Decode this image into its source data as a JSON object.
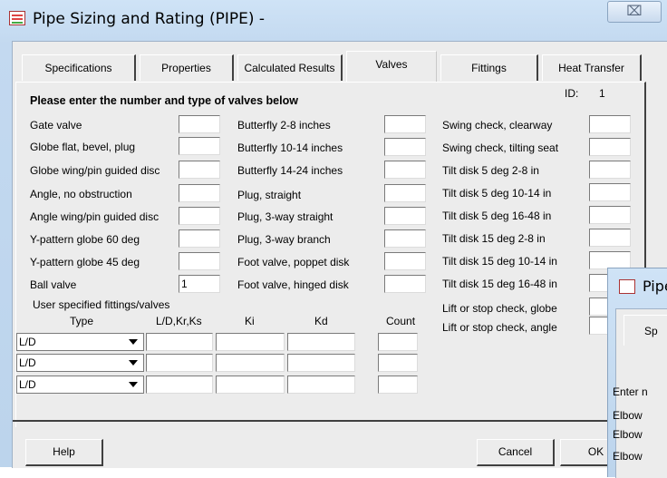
{
  "window": {
    "title": "Pipe Sizing and Rating (PIPE)  -",
    "close_glyph": "⌧"
  },
  "tabs": [
    {
      "label": "Specifications"
    },
    {
      "label": "Properties"
    },
    {
      "label": "Calculated Results"
    },
    {
      "label": "Valves"
    },
    {
      "label": "Fittings"
    },
    {
      "label": "Heat Transfer"
    }
  ],
  "panel": {
    "heading": "Please enter the number and type of valves below",
    "id_label": "ID:",
    "id_value": "1"
  },
  "valves_col1": [
    {
      "label": "Gate valve",
      "value": ""
    },
    {
      "label": "Globe  flat, bevel, plug",
      "value": ""
    },
    {
      "label": "Globe wing/pin guided disc",
      "value": ""
    },
    {
      "label": "Angle, no obstruction",
      "value": ""
    },
    {
      "label": "Angle wing/pin guided disc",
      "value": ""
    },
    {
      "label": "Y-pattern globe 60 deg",
      "value": ""
    },
    {
      "label": "Y-pattern globe 45 deg",
      "value": ""
    },
    {
      "label": "Ball valve",
      "value": "1"
    }
  ],
  "valves_col2": [
    {
      "label": "Butterfly 2-8 inches",
      "value": ""
    },
    {
      "label": "Butterfly 10-14 inches",
      "value": ""
    },
    {
      "label": "Butterfly 14-24 inches",
      "value": ""
    },
    {
      "label": "Plug, straight",
      "value": ""
    },
    {
      "label": "Plug, 3-way straight",
      "value": ""
    },
    {
      "label": "Plug, 3-way branch",
      "value": ""
    },
    {
      "label": "Foot valve, poppet disk",
      "value": ""
    },
    {
      "label": "Foot valve, hinged disk",
      "value": ""
    }
  ],
  "valves_col3": [
    {
      "label": "Swing check, clearway",
      "value": ""
    },
    {
      "label": "Swing check, tilting seat",
      "value": ""
    },
    {
      "label": "Tilt disk 5 deg 2-8 in",
      "value": ""
    },
    {
      "label": "Tilt disk 5 deg 10-14 in",
      "value": ""
    },
    {
      "label": "Tilt disk 5 deg 16-48 in",
      "value": ""
    },
    {
      "label": "Tilt disk 15 deg 2-8 in",
      "value": ""
    },
    {
      "label": "Tilt disk 15 deg 10-14 in",
      "value": ""
    },
    {
      "label": "Tilt disk 15 deg 16-48 in",
      "value": ""
    },
    {
      "label": "Lift or stop check, globe",
      "value": ""
    },
    {
      "label": "Lift or stop check, angle",
      "value": ""
    }
  ],
  "user_fittings": {
    "section_label": "User specified fittings/valves",
    "headers": {
      "type": "Type",
      "ldk": "L/D,Kr,Ks",
      "ki": "Ki",
      "kd": "Kd",
      "count": "Count"
    },
    "rows": [
      {
        "type": "L/D",
        "ldk": "",
        "ki": "",
        "kd": "",
        "count": ""
      },
      {
        "type": "L/D",
        "ldk": "",
        "ki": "",
        "kd": "",
        "count": ""
      },
      {
        "type": "L/D",
        "ldk": "",
        "ki": "",
        "kd": "",
        "count": ""
      }
    ]
  },
  "buttons": {
    "help": "Help",
    "cancel": "Cancel",
    "ok": "OK"
  },
  "second_window": {
    "title": "Pipe",
    "tab_label": "Sp",
    "enter_text": "Enter n",
    "items": [
      "Elbow",
      "Elbow",
      "Elbow"
    ]
  }
}
